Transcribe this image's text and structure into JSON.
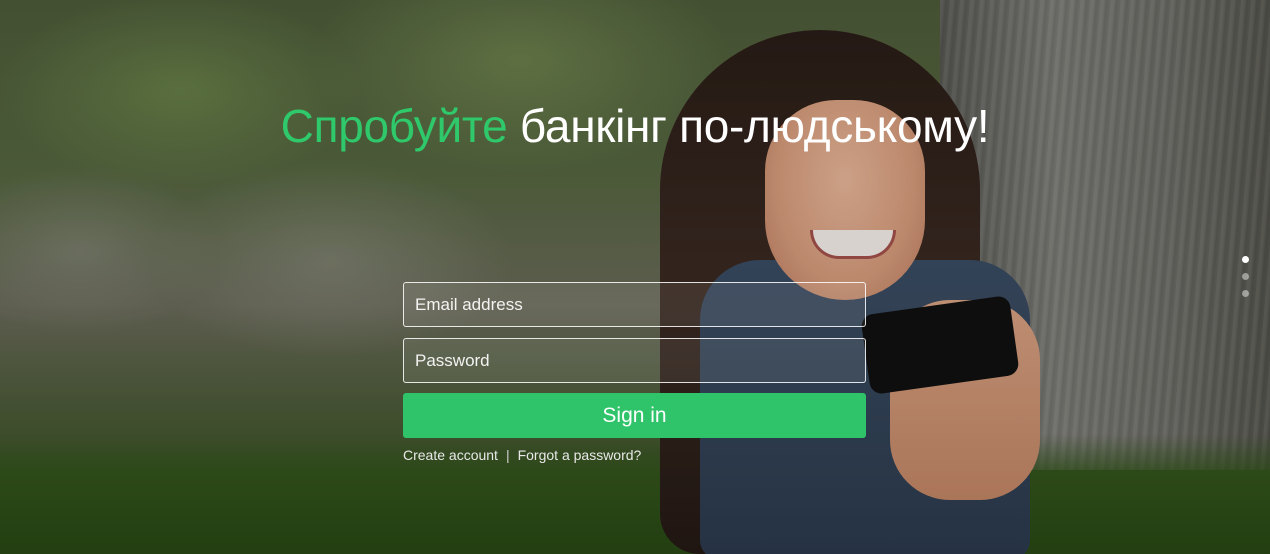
{
  "hero": {
    "headline_accent": "Спробуйте",
    "headline_rest": "банкінг по-людському!"
  },
  "login": {
    "email_placeholder": "Email address",
    "password_placeholder": "Password",
    "signin_label": "Sign in",
    "create_account_label": "Create account",
    "separator": "|",
    "forgot_password_label": "Forgot a password?"
  },
  "slider": {
    "slide_count": 3,
    "active_slide": 1
  },
  "colors": {
    "accent": "#2fc86a",
    "button": "#2fc46a",
    "text": "#ffffff"
  }
}
